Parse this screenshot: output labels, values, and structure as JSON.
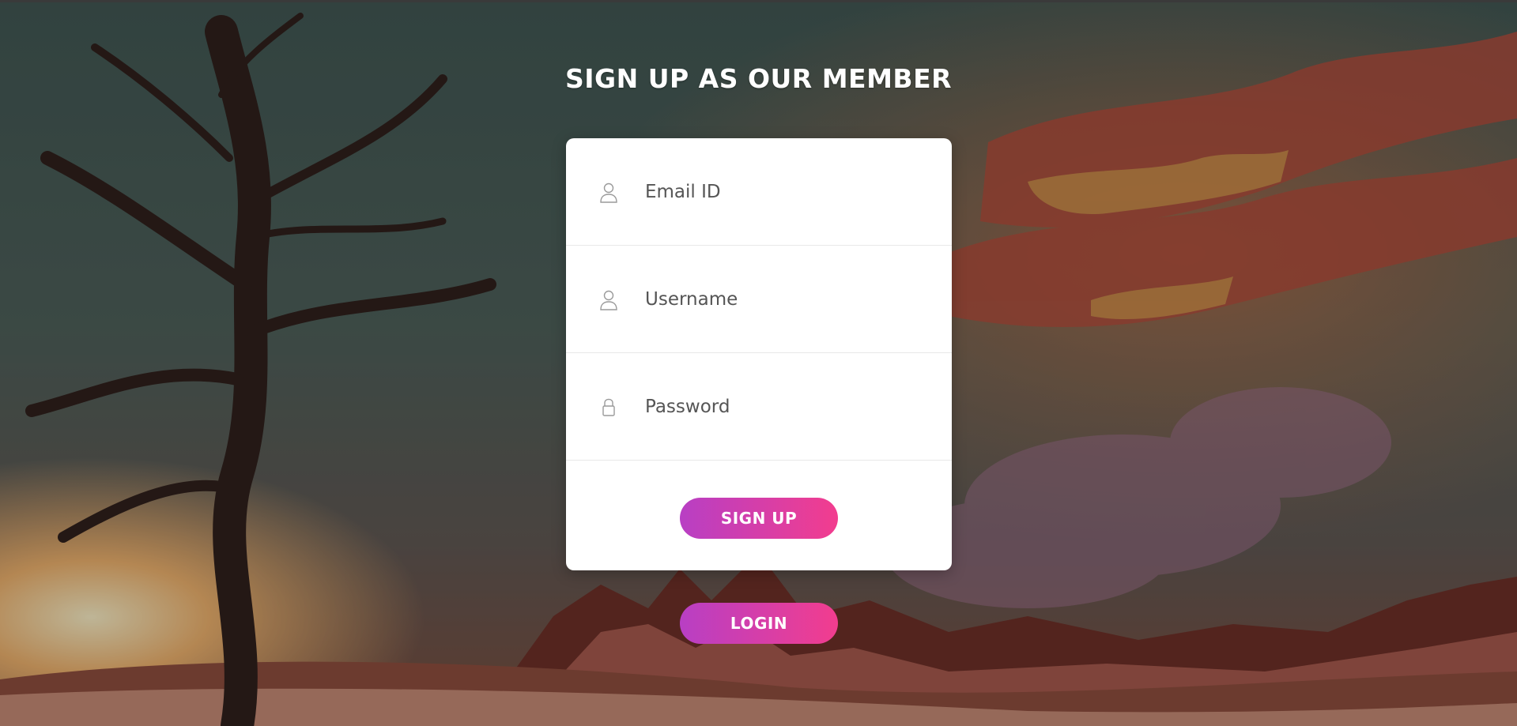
{
  "form": {
    "title": "SIGN UP AS OUR MEMBER",
    "fields": [
      {
        "icon": "user-icon",
        "placeholder": "Email ID",
        "value": ""
      },
      {
        "icon": "user-icon",
        "placeholder": "Username",
        "value": ""
      },
      {
        "icon": "lock-icon",
        "placeholder": "Password",
        "value": ""
      }
    ],
    "signup_label": "SIGN UP"
  },
  "login_label": "LOGIN",
  "colors": {
    "button_gradient_start": "#b83fc4",
    "button_gradient_end": "#f23d8e",
    "card_background": "#ffffff",
    "title_color": "#ffffff"
  }
}
